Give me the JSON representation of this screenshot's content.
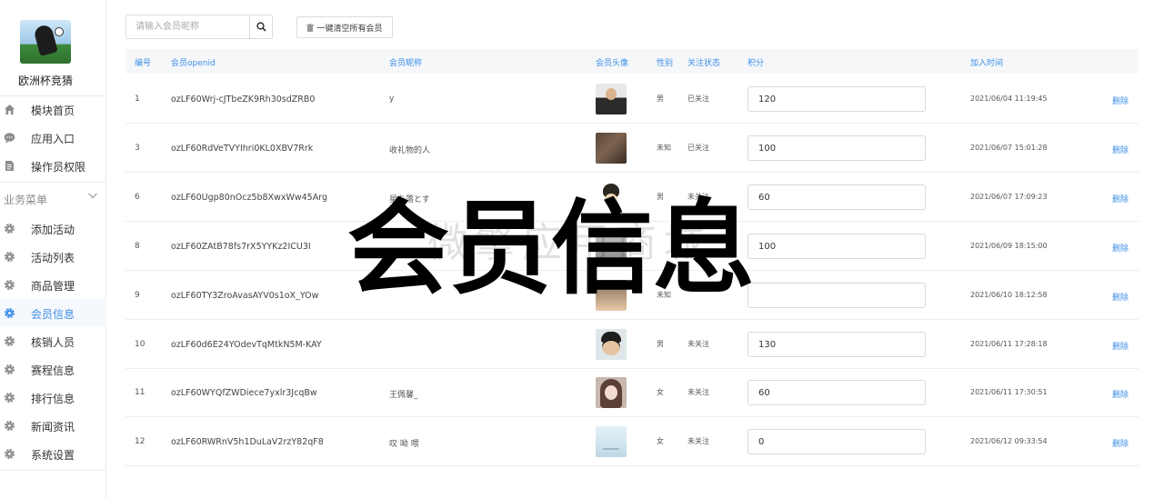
{
  "sidebar": {
    "app_name": "欧洲杯竞猜",
    "top_items": [
      {
        "label": "模块首页",
        "icon": "home-icon"
      },
      {
        "label": "应用入口",
        "icon": "chat-icon"
      },
      {
        "label": "操作员权限",
        "icon": "document-icon"
      }
    ],
    "section_label": "业务菜单",
    "items": [
      {
        "label": "添加活动",
        "icon": "gear-icon"
      },
      {
        "label": "活动列表",
        "icon": "gear-icon"
      },
      {
        "label": "商品管理",
        "icon": "gear-icon"
      },
      {
        "label": "会员信息",
        "icon": "gear-icon",
        "active": true
      },
      {
        "label": "核销人员",
        "icon": "gear-icon"
      },
      {
        "label": "赛程信息",
        "icon": "gear-icon"
      },
      {
        "label": "排行信息",
        "icon": "gear-icon"
      },
      {
        "label": "新闻资讯",
        "icon": "gear-icon"
      },
      {
        "label": "系统设置",
        "icon": "gear-icon"
      }
    ]
  },
  "toolbar": {
    "search_placeholder": "请输入会员昵称",
    "search_value": "",
    "clear_label": "一键清空所有会员"
  },
  "table": {
    "headers": {
      "id": "编号",
      "openid": "会员openid",
      "nickname": "会员昵称",
      "avatar": "会员头像",
      "gender": "性别",
      "follow": "关注状态",
      "points": "积分",
      "join_time": "加入时间"
    },
    "delete_label": "删除",
    "rows": [
      {
        "id": "1",
        "openid": "ozLF60Wrj-cJTbeZK9Rh30sdZRB0",
        "nickname": "y",
        "gender": "男",
        "follow": "已关注",
        "points": "120",
        "join_time": "2021/06/04 11:19:45"
      },
      {
        "id": "3",
        "openid": "ozLF60RdVeTVYIhri0KL0XBV7Rrk",
        "nickname": "收礼物的人",
        "gender": "未知",
        "follow": "已关注",
        "points": "100",
        "join_time": "2021/06/07 15:01:28"
      },
      {
        "id": "6",
        "openid": "ozLF60Ugp80nOcz5b8XwxWw45Arg",
        "nickname": "星を落とす",
        "gender": "男",
        "follow": "未关注",
        "points": "60",
        "join_time": "2021/06/07 17:09:23"
      },
      {
        "id": "8",
        "openid": "ozLF60ZAtB78fs7rX5YYKz2ICU3I",
        "nickname": "",
        "gender": "",
        "follow": "",
        "points": "100",
        "join_time": "2021/06/09 18:15:00"
      },
      {
        "id": "9",
        "openid": "ozLF60TY3ZroAvasAYV0s1oX_YOw",
        "nickname": "",
        "gender": "未知",
        "follow": "",
        "points": "",
        "join_time": "2021/06/10 18:12:58"
      },
      {
        "id": "10",
        "openid": "ozLF60d6E24YOdevTqMtkN5M-KAY",
        "nickname": "",
        "gender": "男",
        "follow": "未关注",
        "points": "130",
        "join_time": "2021/06/11 17:28:18"
      },
      {
        "id": "11",
        "openid": "ozLF60WYQfZWDiece7yxlr3JcqBw",
        "nickname": "王佩馨_",
        "gender": "女",
        "follow": "未关注",
        "points": "60",
        "join_time": "2021/06/11 17:30:51"
      },
      {
        "id": "12",
        "openid": "ozLF60RWRnV5h1DuLaV2rzY82qF8",
        "nickname": "叹 呦 喂",
        "gender": "女",
        "follow": "未关注",
        "points": "0",
        "join_time": "2021/06/12 09:33:54"
      }
    ]
  },
  "watermark": {
    "title": "会员信息",
    "subtitle": "微擎应用商城"
  },
  "colors": {
    "accent": "#3d8ee8",
    "header_bg": "#f6f7f9",
    "border": "#ececec"
  }
}
